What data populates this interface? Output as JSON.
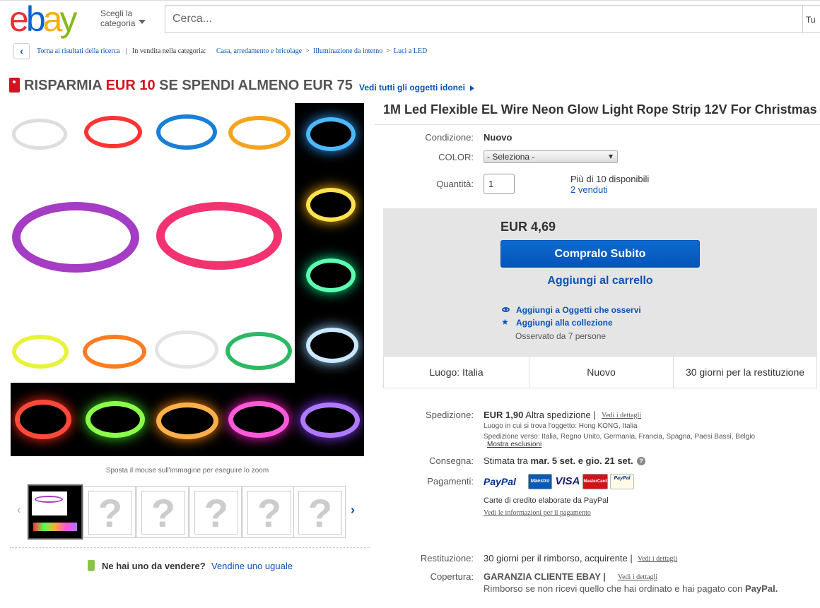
{
  "header": {
    "category_label": [
      "Scegli la",
      "categoria"
    ],
    "search_placeholder": "Cerca...",
    "search_category": "Tu",
    "logo_letters": [
      "e",
      "b",
      "a",
      "y"
    ],
    "logo_colors": [
      "#e53238",
      "#0064d2",
      "#f5af02",
      "#86b817"
    ]
  },
  "breadcrumb": {
    "back": "Torna ai risultati della ricerca",
    "sold_in": "In vendita nella categoria:",
    "path": [
      "Casa, arredamento e bricolage",
      "Illuminazione da interno",
      "Luci a LED"
    ]
  },
  "promo": {
    "text_a": "RISPARMIA",
    "amount": "EUR 10",
    "text_b": "SE SPENDI ALMENO EUR 75",
    "link": "Vedi tutti gli oggetti idonei"
  },
  "gallery": {
    "zoom_hint": "Sposta il mouse sull'immagine per eseguire lo zoom",
    "placeholder_glyph": "?",
    "sell_question": "Ne hai uno da vendere?",
    "sell_link": "Vendine uno uguale"
  },
  "product": {
    "title": "1M Led Flexible EL Wire Neon Glow Light Rope Strip 12V For Christmas",
    "condition_label": "Condizione:",
    "condition": "Nuovo",
    "color_label": "COLOR:",
    "color_select": "- Seleziona -",
    "qty_label": "Quantità:",
    "qty_value": "1",
    "available": "Più di 10 disponibili",
    "sold": "2 venduti",
    "price": "EUR 4,69",
    "buy_now": "Compralo Subito",
    "add_cart": "Aggiungi al carrello",
    "watch": "Aggiungi a Oggetti che osservi",
    "collection": "Aggiungi alla collezione",
    "watchers": "Osservato da 7 persone"
  },
  "facts": [
    "Luogo: Italia",
    "Nuovo",
    "30 giorni per la restituzione"
  ],
  "shipping": {
    "label": "Spedizione:",
    "cost": "EUR 1,90",
    "method": "Altra spedizione |",
    "details": "Vedi i dettagli",
    "location": "Luogo in cui si trova l'oggetto:  Hong KONG, Italia",
    "ships_to": "Spedizione verso:  Italia, Regno Unito, Germania, Francia, Spagna, Paesi Bassi, Belgio",
    "exclusions": "Mostra esclusioni"
  },
  "delivery": {
    "label": "Consegna:",
    "prefix": "Stimata tra",
    "dates": "mar. 5 set. e gio. 21 set.",
    "help_glyph": "?"
  },
  "payments": {
    "label": "Pagamenti:",
    "logos": [
      "PayPal",
      "Maestro",
      "VISA",
      "MasterCard",
      "PayPal"
    ],
    "cards_note": "Carte di credito elaborate da PayPal",
    "info_link": "Vedi le informazioni per il pagamento"
  },
  "returns": {
    "label": "Restituzione:",
    "text": "30 giorni per il rimborso, acquirente |",
    "details": "Vedi i dettagli"
  },
  "coverage": {
    "label": "Copertura:",
    "title": "GARANZIA CLIENTE EBAY |",
    "details": "Vedi i dettagli",
    "text": "Rimborso se non ricevi quello che hai ordinato e hai pagato con",
    "paypal": "PayPal."
  },
  "colors": {
    "link": "#0654ba",
    "promo_red": "#d3141e",
    "buy_button": "#0654ba",
    "buybox_bg": "#e5e5e5"
  }
}
